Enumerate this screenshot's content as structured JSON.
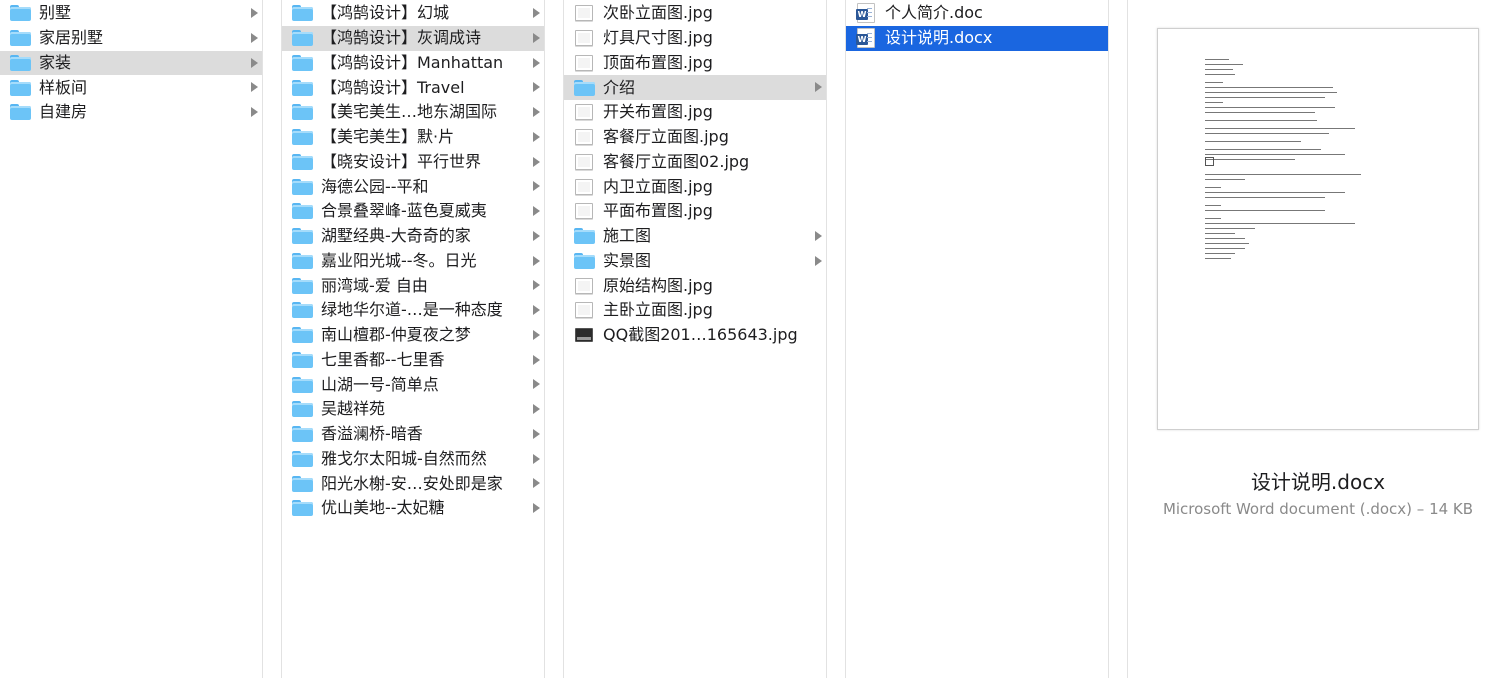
{
  "columns": [
    {
      "items": [
        {
          "label": "别墅",
          "type": "folder",
          "has_children": true,
          "selected": false
        },
        {
          "label": "家居别墅",
          "type": "folder",
          "has_children": true,
          "selected": false
        },
        {
          "label": "家装",
          "type": "folder",
          "has_children": true,
          "selected": "grey"
        },
        {
          "label": "样板间",
          "type": "folder",
          "has_children": true,
          "selected": false
        },
        {
          "label": "自建房",
          "type": "folder",
          "has_children": true,
          "selected": false
        }
      ]
    },
    {
      "items": [
        {
          "label": "【鸿鹄设计】幻城",
          "type": "folder",
          "has_children": true,
          "selected": false
        },
        {
          "label": "【鸿鹄设计】灰调成诗",
          "type": "folder",
          "has_children": true,
          "selected": "grey"
        },
        {
          "label": "【鸿鹄设计】Manhattan",
          "type": "folder",
          "has_children": true,
          "selected": false
        },
        {
          "label": "【鸿鹄设计】Travel",
          "type": "folder",
          "has_children": true,
          "selected": false
        },
        {
          "label": "【美宅美生…地东湖国际",
          "type": "folder",
          "has_children": true,
          "selected": false
        },
        {
          "label": "【美宅美生】默·片",
          "type": "folder",
          "has_children": true,
          "selected": false
        },
        {
          "label": "【晓安设计】平行世界",
          "type": "folder",
          "has_children": true,
          "selected": false
        },
        {
          "label": "海德公园--平和",
          "type": "folder",
          "has_children": true,
          "selected": false
        },
        {
          "label": "合景叠翠峰-蓝色夏威夷",
          "type": "folder",
          "has_children": true,
          "selected": false
        },
        {
          "label": "湖墅经典-大奇奇的家",
          "type": "folder",
          "has_children": true,
          "selected": false
        },
        {
          "label": "嘉业阳光城--冬。日光",
          "type": "folder",
          "has_children": true,
          "selected": false
        },
        {
          "label": "丽湾域-爱 自由",
          "type": "folder",
          "has_children": true,
          "selected": false
        },
        {
          "label": "绿地华尔道-…是一种态度",
          "type": "folder",
          "has_children": true,
          "selected": false
        },
        {
          "label": "南山檀郡-仲夏夜之梦",
          "type": "folder",
          "has_children": true,
          "selected": false
        },
        {
          "label": "七里香都--七里香",
          "type": "folder",
          "has_children": true,
          "selected": false
        },
        {
          "label": "山湖一号-简单点",
          "type": "folder",
          "has_children": true,
          "selected": false
        },
        {
          "label": "吴越祥苑",
          "type": "folder",
          "has_children": true,
          "selected": false
        },
        {
          "label": "香溢澜桥-暗香",
          "type": "folder",
          "has_children": true,
          "selected": false
        },
        {
          "label": "雅戈尔太阳城-自然而然",
          "type": "folder",
          "has_children": true,
          "selected": false
        },
        {
          "label": "阳光水榭-安…安处即是家",
          "type": "folder",
          "has_children": true,
          "selected": false
        },
        {
          "label": "优山美地--太妃糖",
          "type": "folder",
          "has_children": true,
          "selected": false
        }
      ]
    },
    {
      "items": [
        {
          "label": "次卧立面图.jpg",
          "type": "image",
          "has_children": false,
          "selected": false
        },
        {
          "label": "灯具尺寸图.jpg",
          "type": "image",
          "has_children": false,
          "selected": false
        },
        {
          "label": "顶面布置图.jpg",
          "type": "image",
          "has_children": false,
          "selected": false
        },
        {
          "label": "介绍",
          "type": "folder",
          "has_children": true,
          "selected": "grey"
        },
        {
          "label": "开关布置图.jpg",
          "type": "image",
          "has_children": false,
          "selected": false
        },
        {
          "label": "客餐厅立面图.jpg",
          "type": "image",
          "has_children": false,
          "selected": false
        },
        {
          "label": "客餐厅立面图02.jpg",
          "type": "image",
          "has_children": false,
          "selected": false
        },
        {
          "label": "内卫立面图.jpg",
          "type": "image",
          "has_children": false,
          "selected": false
        },
        {
          "label": "平面布置图.jpg",
          "type": "image",
          "has_children": false,
          "selected": false
        },
        {
          "label": "施工图",
          "type": "folder",
          "has_children": true,
          "selected": false
        },
        {
          "label": "实景图",
          "type": "folder",
          "has_children": true,
          "selected": false
        },
        {
          "label": "原始结构图.jpg",
          "type": "image",
          "has_children": false,
          "selected": false
        },
        {
          "label": "主卧立面图.jpg",
          "type": "image",
          "has_children": false,
          "selected": false
        },
        {
          "label": "QQ截图201…165643.jpg",
          "type": "screenshot",
          "has_children": false,
          "selected": false
        }
      ]
    },
    {
      "items": [
        {
          "label": "个人简介.doc",
          "type": "doc",
          "has_children": false,
          "selected": false
        },
        {
          "label": "设计说明.docx",
          "type": "doc",
          "has_children": false,
          "selected": "blue"
        }
      ]
    }
  ],
  "preview": {
    "file_name": "设计说明.docx",
    "file_meta": "Microsoft Word document (.docx) – 14 KB"
  },
  "colors": {
    "selection_blue": "#1a66e0",
    "selection_grey": "#dcdcdc",
    "folder": "#6cc4f7"
  }
}
